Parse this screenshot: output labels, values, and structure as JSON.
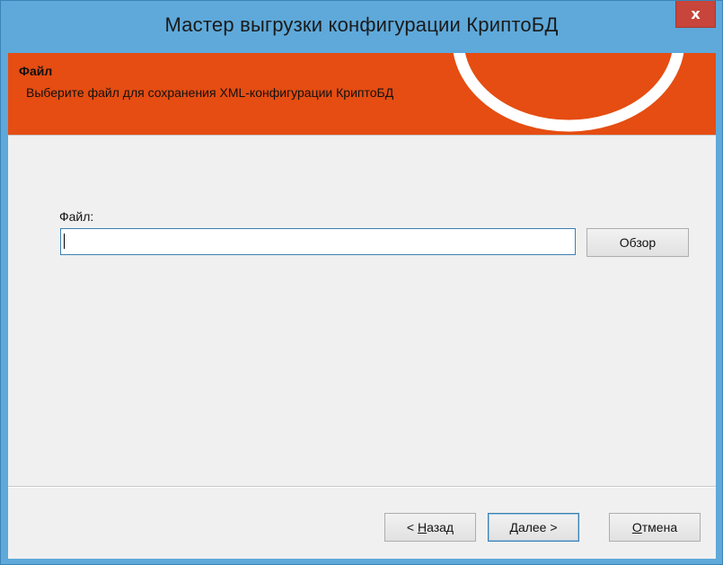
{
  "window": {
    "title": "Мастер выгрузки конфигурации КриптоБД",
    "close_glyph": "x"
  },
  "header": {
    "title": "Файл",
    "subtitle": "Выберите файл для сохранения XML-конфигурации КриптоБД"
  },
  "form": {
    "file_label": "Файл:",
    "file_value": "",
    "browse_label": "Обзор"
  },
  "footer": {
    "back_prefix": "< ",
    "back_accel": "Н",
    "back_rest": "азад",
    "next_accel": "Д",
    "next_rest": "алее >",
    "cancel_accel": "О",
    "cancel_rest": "тмена"
  },
  "colors": {
    "titlebar": "#5ea9da",
    "banner": "#e54d12",
    "close": "#c7453a",
    "client": "#f0f0f0"
  }
}
